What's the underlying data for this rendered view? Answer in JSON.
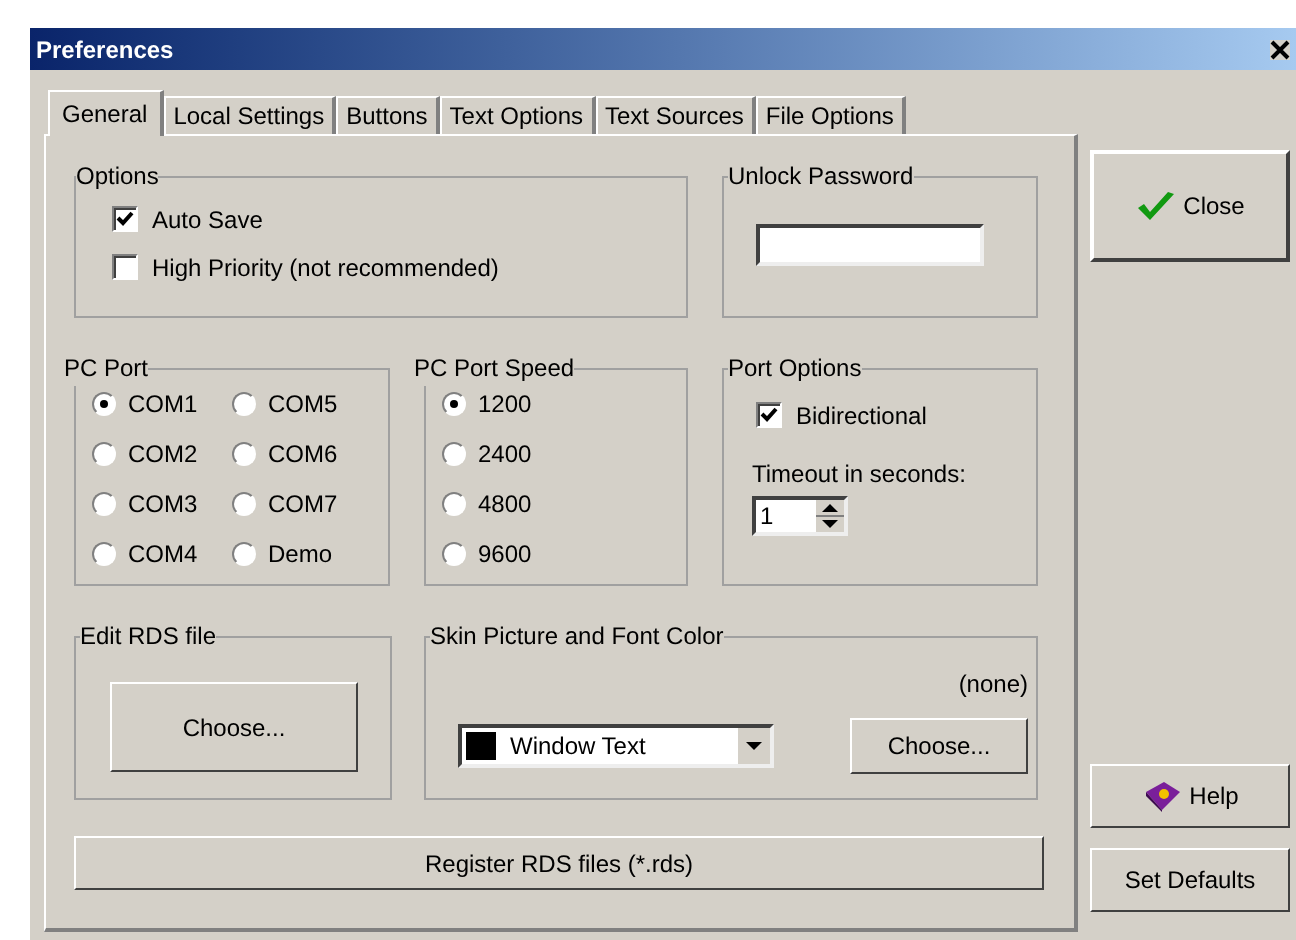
{
  "window": {
    "title": "Preferences"
  },
  "tabs": [
    {
      "label": "General",
      "selected": true
    },
    {
      "label": "Local Settings",
      "selected": false
    },
    {
      "label": "Buttons",
      "selected": false
    },
    {
      "label": "Text Options",
      "selected": false
    },
    {
      "label": "Text Sources",
      "selected": false
    },
    {
      "label": "File Options",
      "selected": false
    }
  ],
  "options": {
    "title": "Options",
    "checkboxes": [
      {
        "label": "Auto Save",
        "checked": true
      },
      {
        "label": "High Priority (not recommended)",
        "checked": false
      }
    ]
  },
  "unlock_password": {
    "title": "Unlock Password"
  },
  "pc_port": {
    "title": "PC Port",
    "radios": [
      {
        "label": "COM1",
        "selected": true
      },
      {
        "label": "COM5",
        "selected": false
      },
      {
        "label": "COM2",
        "selected": false
      },
      {
        "label": "COM6",
        "selected": false
      },
      {
        "label": "COM3",
        "selected": false
      },
      {
        "label": "COM7",
        "selected": false
      },
      {
        "label": "COM4",
        "selected": false
      },
      {
        "label": "Demo",
        "selected": false
      }
    ]
  },
  "pc_port_speed": {
    "title": "PC Port Speed",
    "radios": [
      {
        "label": "1200",
        "selected": true
      },
      {
        "label": "2400",
        "selected": false
      },
      {
        "label": "4800",
        "selected": false
      },
      {
        "label": "9600",
        "selected": false
      }
    ]
  },
  "port_options": {
    "title": "Port Options",
    "checkbox": {
      "label": "Bidirectional",
      "checked": true
    },
    "timeout_label": "Timeout in seconds:",
    "timeout_value": "1"
  },
  "edit_rds": {
    "title": "Edit RDS file",
    "button": "Choose..."
  },
  "skin": {
    "title": "Skin Picture and Font Color",
    "picture": "(none)",
    "font_color": {
      "value": "Window Text",
      "color": "#000000"
    },
    "button": "Choose..."
  },
  "register_button": "Register RDS files (*.rds)",
  "side_buttons": [
    {
      "label": "Close",
      "kind": "check"
    },
    {
      "label": "Help",
      "kind": "book"
    },
    {
      "label": "Set Defaults",
      "kind": "plain"
    }
  ]
}
